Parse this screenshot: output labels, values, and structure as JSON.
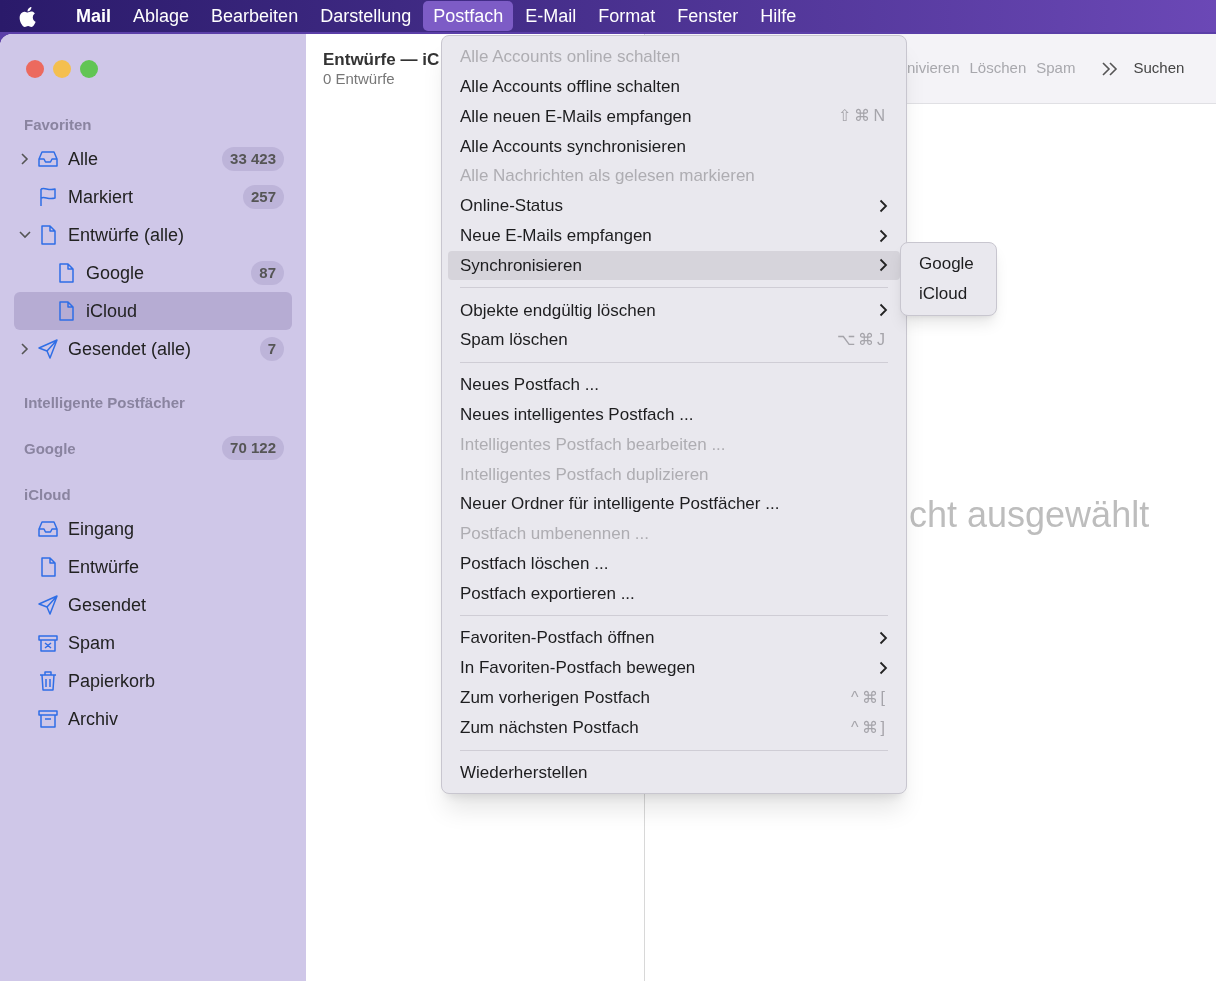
{
  "menubar": [
    {
      "label": "Mail",
      "selected": false,
      "app": true
    },
    {
      "label": "Ablage",
      "selected": false
    },
    {
      "label": "Bearbeiten",
      "selected": false
    },
    {
      "label": "Darstellung",
      "selected": false
    },
    {
      "label": "Postfach",
      "selected": true
    },
    {
      "label": "E-Mail",
      "selected": false
    },
    {
      "label": "Format",
      "selected": false
    },
    {
      "label": "Fenster",
      "selected": false
    },
    {
      "label": "Hilfe",
      "selected": false
    }
  ],
  "sidebar": [
    {
      "label": "Favoriten",
      "items": [
        {
          "label": "Alle",
          "kind": "inbox",
          "count": "33 423",
          "expanded": false,
          "selected": false
        },
        {
          "label": "Markiert",
          "kind": "flag",
          "count": "257",
          "selected": false
        },
        {
          "label": "Entwürfe (alle)",
          "kind": "document",
          "expanded": true,
          "selected": false,
          "children": [
            {
              "label": "Google",
              "kind": "document",
              "count": "87",
              "selected": false
            },
            {
              "label": "iCloud",
              "kind": "document",
              "selected": true
            }
          ]
        },
        {
          "label": "Gesendet (alle)",
          "kind": "sent",
          "count": "7",
          "expanded": false,
          "selected": false
        }
      ]
    },
    {
      "label": "Intelligente Postfächer"
    },
    {
      "label": "Google",
      "count": "70 122"
    },
    {
      "label": "iCloud",
      "items": [
        {
          "label": "Eingang",
          "kind": "inbox",
          "selected": false
        },
        {
          "label": "Entwürfe",
          "kind": "document",
          "selected": false
        },
        {
          "label": "Gesendet",
          "kind": "sent",
          "selected": false
        },
        {
          "label": "Spam",
          "kind": "junk",
          "selected": false
        },
        {
          "label": "Papierkorb",
          "kind": "trash",
          "selected": false
        },
        {
          "label": "Archiv",
          "kind": "archive",
          "selected": false
        }
      ]
    }
  ],
  "message_list": {
    "title": "Entwürfe — iC",
    "subtitle": "0 Entwürfe"
  },
  "toolbar": {
    "buttons": [
      "nivieren",
      "Löschen",
      "Spam"
    ],
    "search": "Suchen"
  },
  "viewer": {
    "empty_text": "cht ausgewählt"
  },
  "menu": [
    {
      "kind": "item",
      "label": "Alle Accounts online schalten",
      "disabled": true,
      "submenu": false,
      "selected": false
    },
    {
      "kind": "item",
      "label": "Alle Accounts offline schalten",
      "disabled": false,
      "submenu": false,
      "selected": false
    },
    {
      "kind": "item",
      "label": "Alle neuen E-Mails empfangen",
      "disabled": false,
      "submenu": false,
      "selected": false,
      "shortcut": "⇧⌘N"
    },
    {
      "kind": "item",
      "label": "Alle Accounts synchronisieren",
      "disabled": false,
      "submenu": false,
      "selected": false
    },
    {
      "kind": "item",
      "label": "Alle Nachrichten als gelesen markieren",
      "disabled": true,
      "submenu": false,
      "selected": false
    },
    {
      "kind": "item",
      "label": "Online-Status",
      "disabled": false,
      "submenu": true,
      "selected": false
    },
    {
      "kind": "item",
      "label": "Neue E-Mails empfangen",
      "disabled": false,
      "submenu": true,
      "selected": false
    },
    {
      "kind": "item",
      "label": "Synchronisieren",
      "disabled": false,
      "submenu": true,
      "selected": true
    },
    {
      "kind": "separator"
    },
    {
      "kind": "item",
      "label": "Objekte endgültig löschen",
      "disabled": false,
      "submenu": true,
      "selected": false
    },
    {
      "kind": "item",
      "label": "Spam löschen",
      "disabled": false,
      "submenu": false,
      "selected": false,
      "shortcut": "⌥⌘J"
    },
    {
      "kind": "separator"
    },
    {
      "kind": "item",
      "label": "Neues Postfach ...",
      "disabled": false,
      "submenu": false,
      "selected": false
    },
    {
      "kind": "item",
      "label": "Neues intelligentes Postfach ...",
      "disabled": false,
      "submenu": false,
      "selected": false
    },
    {
      "kind": "item",
      "label": "Intelligentes Postfach bearbeiten ...",
      "disabled": true,
      "submenu": false,
      "selected": false
    },
    {
      "kind": "item",
      "label": "Intelligentes Postfach duplizieren",
      "disabled": true,
      "submenu": false,
      "selected": false
    },
    {
      "kind": "item",
      "label": "Neuer Ordner für intelligente Postfächer ...",
      "disabled": false,
      "submenu": false,
      "selected": false
    },
    {
      "kind": "item",
      "label": "Postfach umbenennen ...",
      "disabled": true,
      "submenu": false,
      "selected": false
    },
    {
      "kind": "item",
      "label": "Postfach löschen ...",
      "disabled": false,
      "submenu": false,
      "selected": false
    },
    {
      "kind": "item",
      "label": "Postfach exportieren ...",
      "disabled": false,
      "submenu": false,
      "selected": false
    },
    {
      "kind": "separator"
    },
    {
      "kind": "item",
      "label": "Favoriten-Postfach öffnen",
      "disabled": false,
      "submenu": true,
      "selected": false
    },
    {
      "kind": "item",
      "label": "In Favoriten-Postfach bewegen",
      "disabled": false,
      "submenu": true,
      "selected": false
    },
    {
      "kind": "item",
      "label": "Zum vorherigen Postfach",
      "disabled": false,
      "submenu": false,
      "selected": false,
      "shortcut": "^⌘["
    },
    {
      "kind": "item",
      "label": "Zum nächsten Postfach",
      "disabled": false,
      "submenu": false,
      "selected": false,
      "shortcut": "^⌘]"
    },
    {
      "kind": "separator"
    },
    {
      "kind": "item",
      "label": "Wiederherstellen",
      "disabled": false,
      "submenu": false,
      "selected": false
    }
  ],
  "submenu": [
    {
      "label": "Google"
    },
    {
      "label": "iCloud"
    }
  ]
}
